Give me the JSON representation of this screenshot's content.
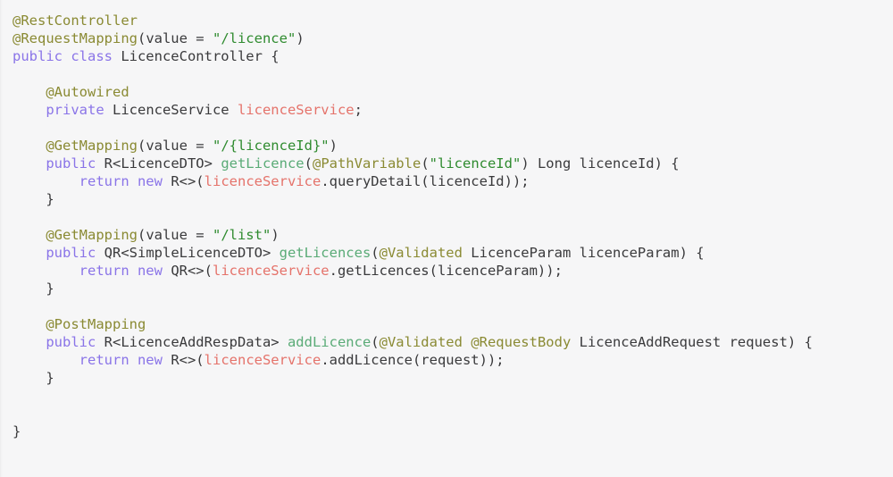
{
  "editor": {
    "language": "java",
    "file_title": "LicenceController",
    "background_color": "#f6f6f7",
    "font_size_px": 15.5,
    "line_height_px": 20,
    "theme_colors": {
      "annotation": "#8a8a33",
      "keyword": "#8a74e8",
      "string": "#2f8b2f",
      "method": "#5aab77",
      "field": "#e5736b",
      "plain": "#3a3a3c"
    }
  },
  "code": {
    "lines": [
      {
        "id": "line-1",
        "tokens": [
          {
            "t": "@RestController",
            "k": "annotation"
          }
        ]
      },
      {
        "id": "line-2",
        "tokens": [
          {
            "t": "@RequestMapping",
            "k": "annotation"
          },
          {
            "t": "(value = ",
            "k": "plain"
          },
          {
            "t": "\"/licence\"",
            "k": "string"
          },
          {
            "t": ")",
            "k": "plain"
          }
        ]
      },
      {
        "id": "line-3",
        "tokens": [
          {
            "t": "public class",
            "k": "keyword"
          },
          {
            "t": " LicenceController {",
            "k": "plain"
          }
        ]
      },
      {
        "id": "line-4",
        "tokens": []
      },
      {
        "id": "line-5",
        "tokens": [
          {
            "t": "    @Autowired",
            "k": "annotation"
          }
        ]
      },
      {
        "id": "line-6",
        "tokens": [
          {
            "t": "    ",
            "k": "plain"
          },
          {
            "t": "private",
            "k": "keyword"
          },
          {
            "t": " LicenceService ",
            "k": "plain"
          },
          {
            "t": "licenceService",
            "k": "field"
          },
          {
            "t": ";",
            "k": "plain"
          }
        ]
      },
      {
        "id": "line-7",
        "tokens": []
      },
      {
        "id": "line-8",
        "tokens": [
          {
            "t": "    @GetMapping",
            "k": "annotation"
          },
          {
            "t": "(value = ",
            "k": "plain"
          },
          {
            "t": "\"/{licenceId}\"",
            "k": "string"
          },
          {
            "t": ")",
            "k": "plain"
          }
        ]
      },
      {
        "id": "line-9",
        "tokens": [
          {
            "t": "    ",
            "k": "plain"
          },
          {
            "t": "public",
            "k": "keyword"
          },
          {
            "t": " R<LicenceDTO> ",
            "k": "plain"
          },
          {
            "t": "getLicence",
            "k": "method"
          },
          {
            "t": "(",
            "k": "plain"
          },
          {
            "t": "@PathVariable",
            "k": "annotation"
          },
          {
            "t": "(",
            "k": "plain"
          },
          {
            "t": "\"licenceId\"",
            "k": "string"
          },
          {
            "t": ") Long licenceId) {",
            "k": "plain"
          }
        ]
      },
      {
        "id": "line-10",
        "tokens": [
          {
            "t": "        ",
            "k": "plain"
          },
          {
            "t": "return new",
            "k": "keyword"
          },
          {
            "t": " R<>(",
            "k": "plain"
          },
          {
            "t": "licenceService",
            "k": "field"
          },
          {
            "t": ".queryDetail(licenceId));",
            "k": "plain"
          }
        ]
      },
      {
        "id": "line-11",
        "tokens": [
          {
            "t": "    }",
            "k": "plain"
          }
        ]
      },
      {
        "id": "line-12",
        "tokens": []
      },
      {
        "id": "line-13",
        "tokens": [
          {
            "t": "    @GetMapping",
            "k": "annotation"
          },
          {
            "t": "(value = ",
            "k": "plain"
          },
          {
            "t": "\"/list\"",
            "k": "string"
          },
          {
            "t": ")",
            "k": "plain"
          }
        ]
      },
      {
        "id": "line-14",
        "tokens": [
          {
            "t": "    ",
            "k": "plain"
          },
          {
            "t": "public",
            "k": "keyword"
          },
          {
            "t": " QR<SimpleLicenceDTO> ",
            "k": "plain"
          },
          {
            "t": "getLicences",
            "k": "method"
          },
          {
            "t": "(",
            "k": "plain"
          },
          {
            "t": "@Validated",
            "k": "annotation"
          },
          {
            "t": " LicenceParam licenceParam) {",
            "k": "plain"
          }
        ]
      },
      {
        "id": "line-15",
        "tokens": [
          {
            "t": "        ",
            "k": "plain"
          },
          {
            "t": "return new",
            "k": "keyword"
          },
          {
            "t": " QR<>(",
            "k": "plain"
          },
          {
            "t": "licenceService",
            "k": "field"
          },
          {
            "t": ".getLicences(licenceParam));",
            "k": "plain"
          }
        ]
      },
      {
        "id": "line-16",
        "tokens": [
          {
            "t": "    }",
            "k": "plain"
          }
        ]
      },
      {
        "id": "line-17",
        "tokens": []
      },
      {
        "id": "line-18",
        "tokens": [
          {
            "t": "    @PostMapping",
            "k": "annotation"
          }
        ]
      },
      {
        "id": "line-19",
        "tokens": [
          {
            "t": "    ",
            "k": "plain"
          },
          {
            "t": "public",
            "k": "keyword"
          },
          {
            "t": " R<LicenceAddRespData> ",
            "k": "plain"
          },
          {
            "t": "addLicence",
            "k": "method"
          },
          {
            "t": "(",
            "k": "plain"
          },
          {
            "t": "@Validated",
            "k": "annotation"
          },
          {
            "t": " ",
            "k": "plain"
          },
          {
            "t": "@RequestBody",
            "k": "annotation"
          },
          {
            "t": " LicenceAddRequest request) {",
            "k": "plain"
          }
        ]
      },
      {
        "id": "line-20",
        "tokens": [
          {
            "t": "        ",
            "k": "plain"
          },
          {
            "t": "return new",
            "k": "keyword"
          },
          {
            "t": " R<>(",
            "k": "plain"
          },
          {
            "t": "licenceService",
            "k": "field"
          },
          {
            "t": ".addLicence(request));",
            "k": "plain"
          }
        ]
      },
      {
        "id": "line-21",
        "tokens": [
          {
            "t": "    }",
            "k": "plain"
          }
        ]
      },
      {
        "id": "line-22",
        "tokens": []
      },
      {
        "id": "line-23",
        "tokens": []
      },
      {
        "id": "line-24",
        "tokens": [
          {
            "t": "}",
            "k": "plain"
          }
        ]
      }
    ]
  }
}
